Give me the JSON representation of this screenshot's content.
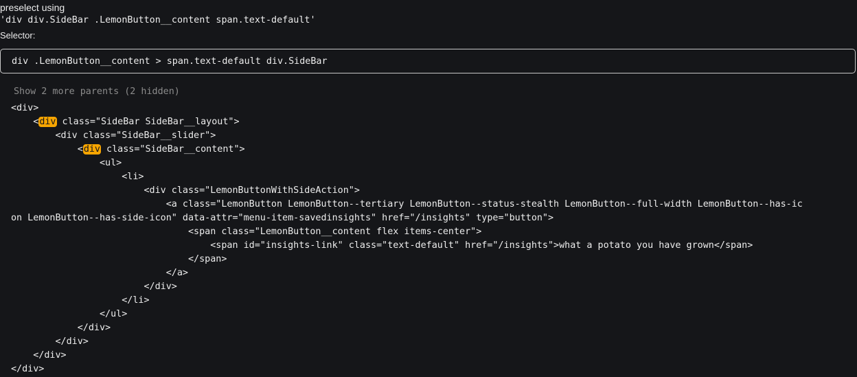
{
  "header": {
    "preselect_label": "preselect using",
    "preselect_value": "'div div.SideBar .LemonButton__content span.text-default'",
    "selector_label": "Selector:",
    "selector_value": "div .LemonButton__content > span.text-default div.SideBar"
  },
  "tree": {
    "show_parents": "Show 2 more parents (2 hidden)",
    "lines": [
      {
        "indent": "",
        "before": "<div>",
        "tag": "",
        "after": ""
      },
      {
        "indent": "    ",
        "before": "<",
        "tag": "div",
        "after": " class=\"SideBar SideBar__layout\">"
      },
      {
        "indent": "        ",
        "before": "<div class=\"SideBar__slider\">",
        "tag": "",
        "after": ""
      },
      {
        "indent": "            ",
        "before": "<",
        "tag": "div",
        "after": " class=\"SideBar__content\">"
      },
      {
        "indent": "                ",
        "before": "<ul>",
        "tag": "",
        "after": ""
      },
      {
        "indent": "                    ",
        "before": "<li>",
        "tag": "",
        "after": ""
      },
      {
        "indent": "                        ",
        "before": "<div class=\"LemonButtonWithSideAction\">",
        "tag": "",
        "after": ""
      },
      {
        "indent": "                            ",
        "before": "<a class=\"LemonButton LemonButton--tertiary LemonButton--status-stealth LemonButton--full-width LemonButton--has-ic",
        "tag": "",
        "after": ""
      },
      {
        "indent": "",
        "before": "on LemonButton--has-side-icon\" data-attr=\"menu-item-savedinsights\" href=\"/insights\" type=\"button\">",
        "tag": "",
        "after": ""
      },
      {
        "indent": "                                ",
        "before": "<span class=\"LemonButton__content flex items-center\">",
        "tag": "",
        "after": ""
      },
      {
        "indent": "                                    ",
        "before": "<span id=\"insights-link\" class=\"text-default\" href=\"/insights\">what a potato you have grown</span>",
        "tag": "",
        "after": ""
      },
      {
        "indent": "                                ",
        "before": "</span>",
        "tag": "",
        "after": ""
      },
      {
        "indent": "                            ",
        "before": "</a>",
        "tag": "",
        "after": ""
      },
      {
        "indent": "                        ",
        "before": "</div>",
        "tag": "",
        "after": ""
      },
      {
        "indent": "                    ",
        "before": "</li>",
        "tag": "",
        "after": ""
      },
      {
        "indent": "                ",
        "before": "</ul>",
        "tag": "",
        "after": ""
      },
      {
        "indent": "            ",
        "before": "</div>",
        "tag": "",
        "after": ""
      },
      {
        "indent": "        ",
        "before": "</div>",
        "tag": "",
        "after": ""
      },
      {
        "indent": "    ",
        "before": "</div>",
        "tag": "",
        "after": ""
      },
      {
        "indent": "",
        "before": "</div>",
        "tag": "",
        "after": ""
      }
    ]
  }
}
